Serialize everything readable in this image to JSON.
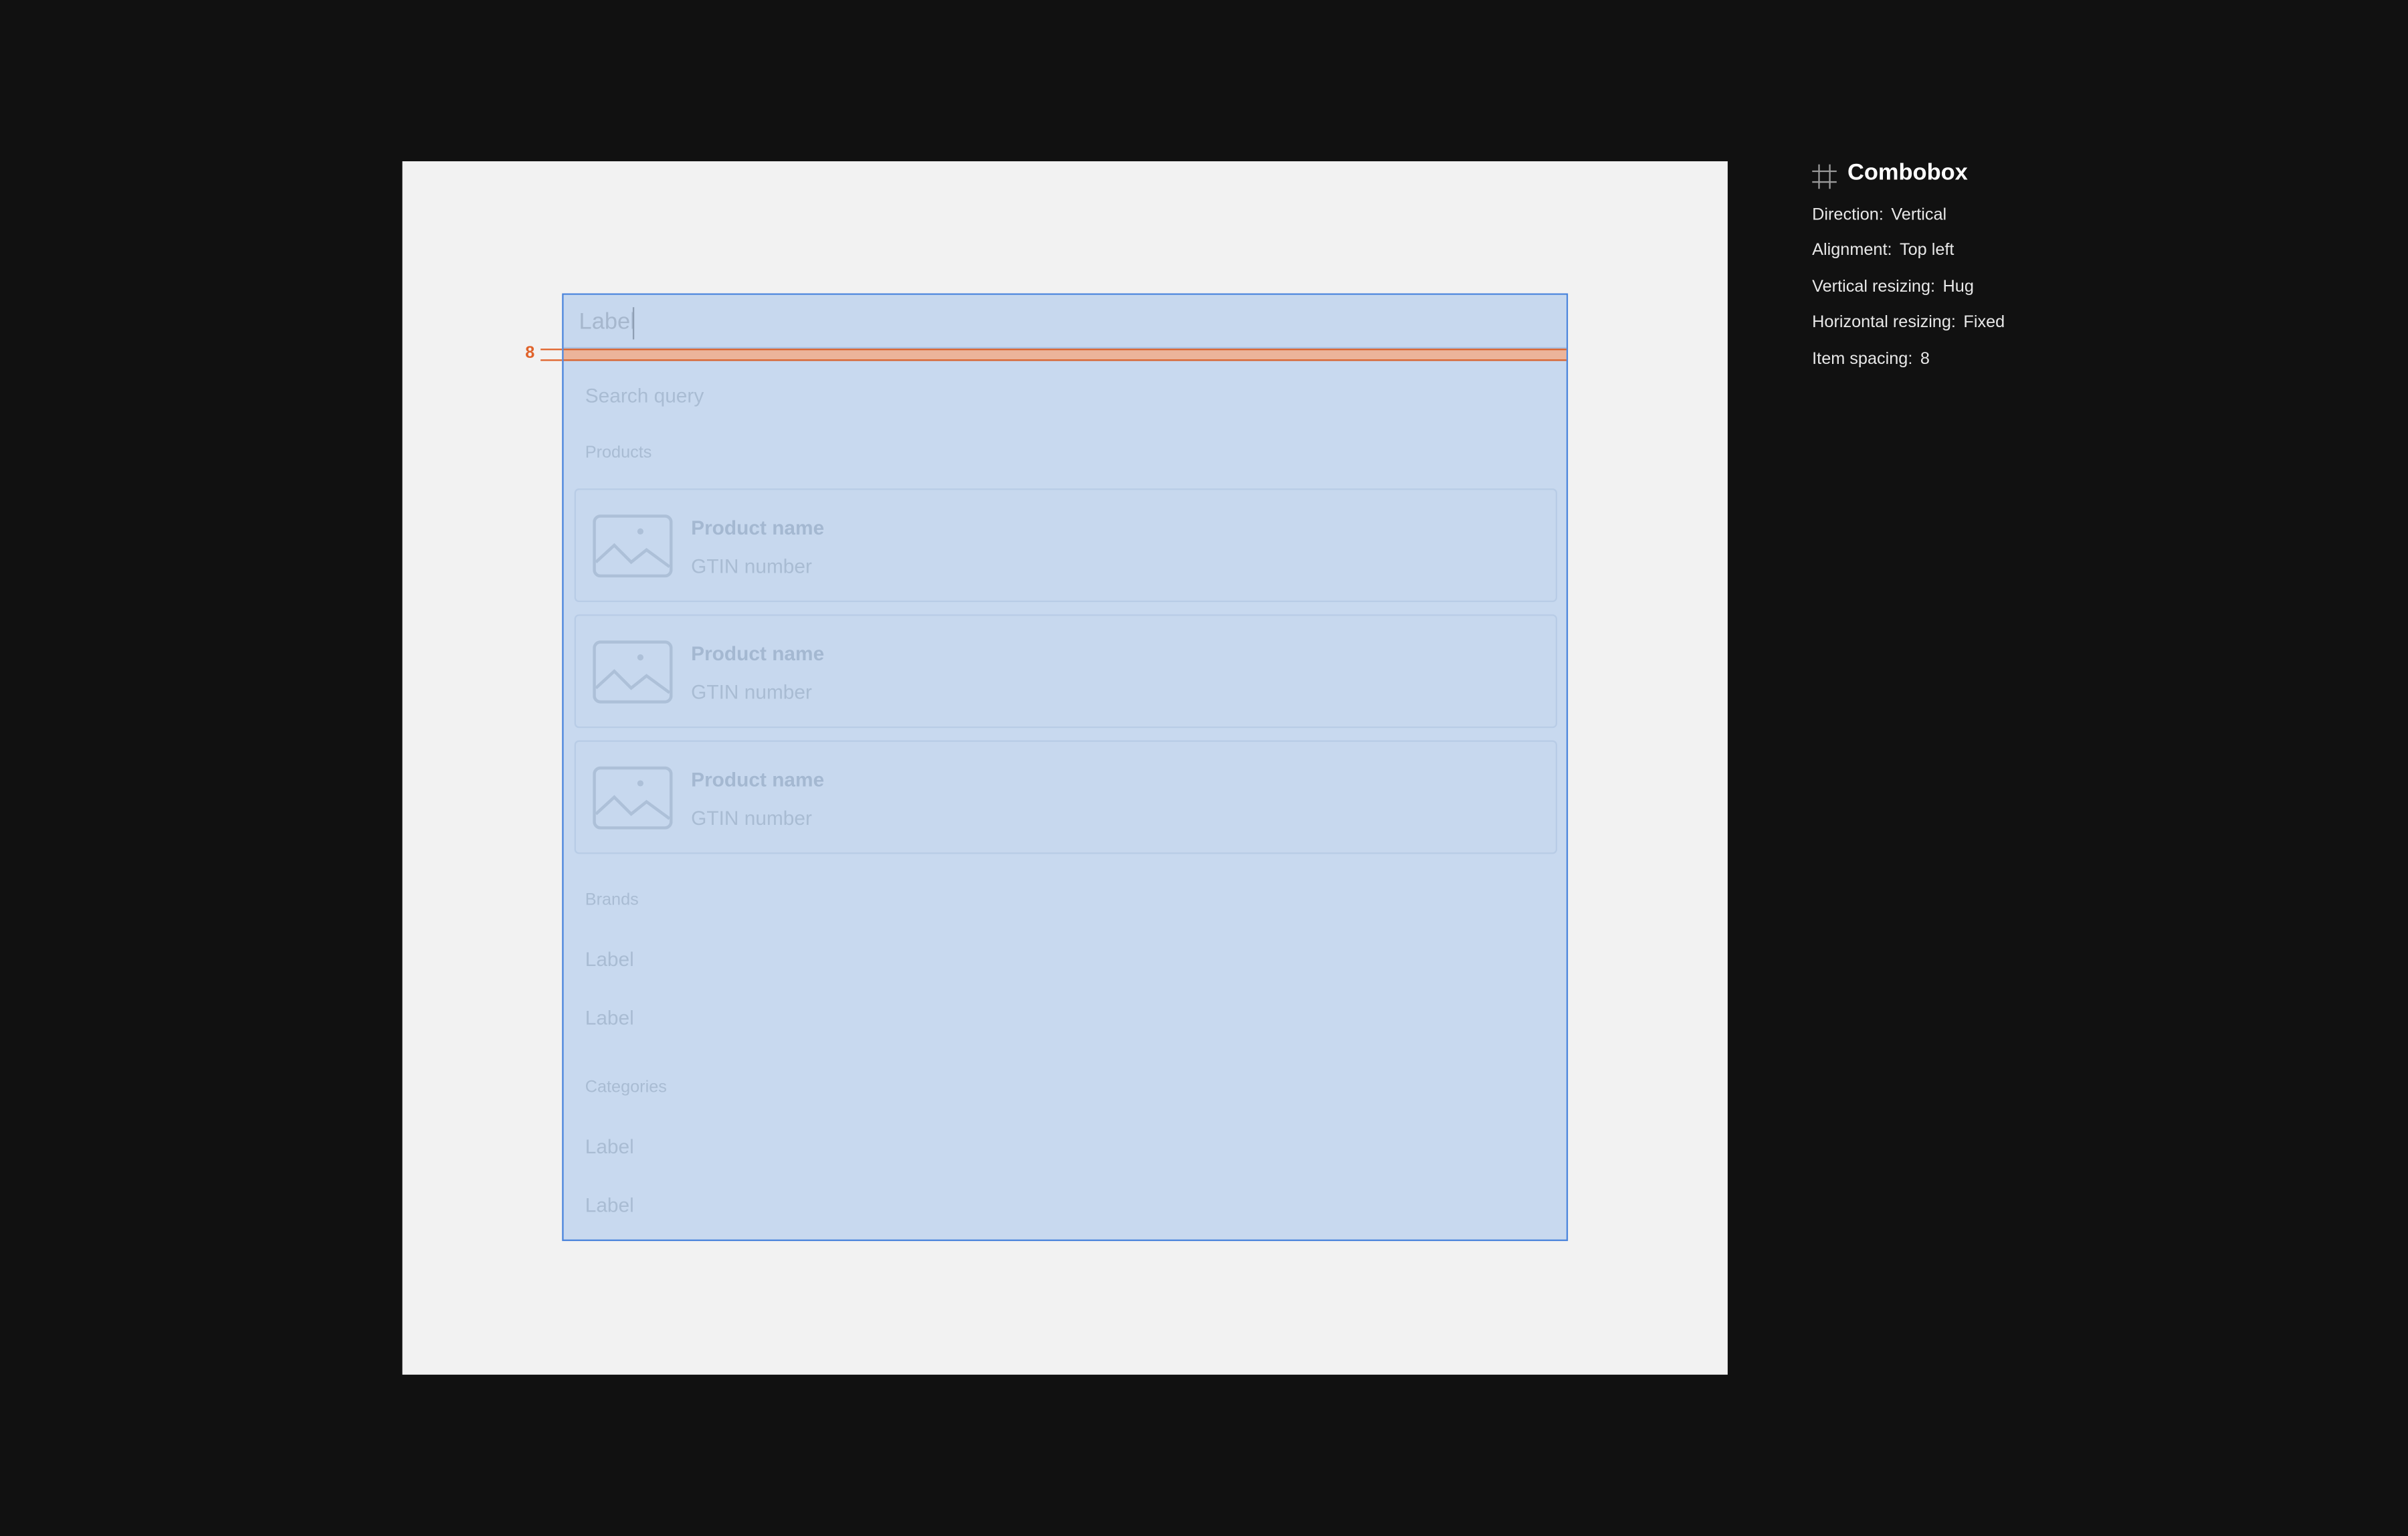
{
  "combobox": {
    "input_label": "Label",
    "search_placeholder": "Search query",
    "spacing_marker": "8",
    "sections": {
      "products": "Products",
      "brands": "Brands",
      "categories": "Categories"
    },
    "products": [
      {
        "name": "Product name",
        "gtin": "GTIN number",
        "icon": "image-placeholder-icon"
      },
      {
        "name": "Product name",
        "gtin": "GTIN number",
        "icon": "image-placeholder-icon"
      },
      {
        "name": "Product name",
        "gtin": "GTIN number",
        "icon": "image-placeholder-icon"
      }
    ],
    "brands": [
      "Label",
      "Label"
    ],
    "categories": [
      "Label",
      "Label"
    ]
  },
  "inspector": {
    "icon": "frame-icon",
    "title": "Combobox",
    "properties": [
      {
        "key": "Direction:",
        "value": "Vertical"
      },
      {
        "key": "Alignment:",
        "value": "Top left"
      },
      {
        "key": "Vertical resizing:",
        "value": "Hug"
      },
      {
        "key": "Horizontal resizing:",
        "value": "Fixed"
      },
      {
        "key": "Item spacing:",
        "value": "8"
      }
    ]
  },
  "colors": {
    "canvas": "#111111",
    "frame": "#f2f2f2",
    "selection_fill": "#c8d9ef",
    "selection_border": "#4a84dc",
    "spacing_highlight": "#e0632b"
  }
}
